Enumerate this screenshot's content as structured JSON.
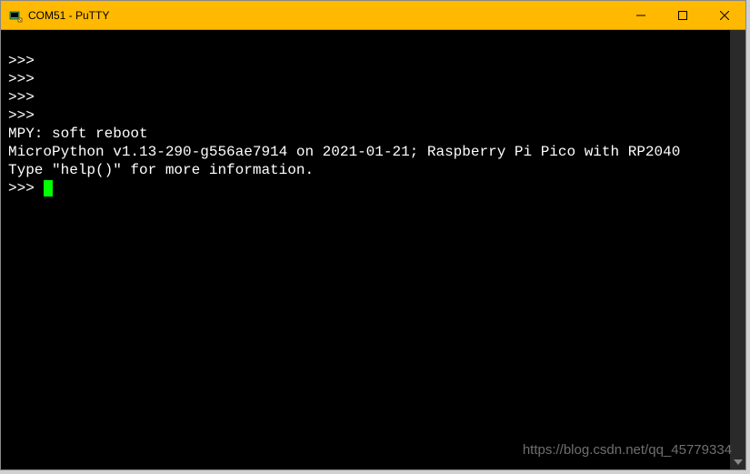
{
  "window": {
    "title": "COM51 - PuTTY"
  },
  "terminal": {
    "lines": [
      ">>>",
      ">>>",
      ">>>",
      ">>>",
      "MPY: soft reboot",
      "MicroPython v1.13-290-g556ae7914 on 2021-01-21; Raspberry Pi Pico with RP2040",
      "Type \"help()\" for more information."
    ],
    "prompt": ">>> "
  },
  "watermark": "https://blog.csdn.net/qq_45779334"
}
